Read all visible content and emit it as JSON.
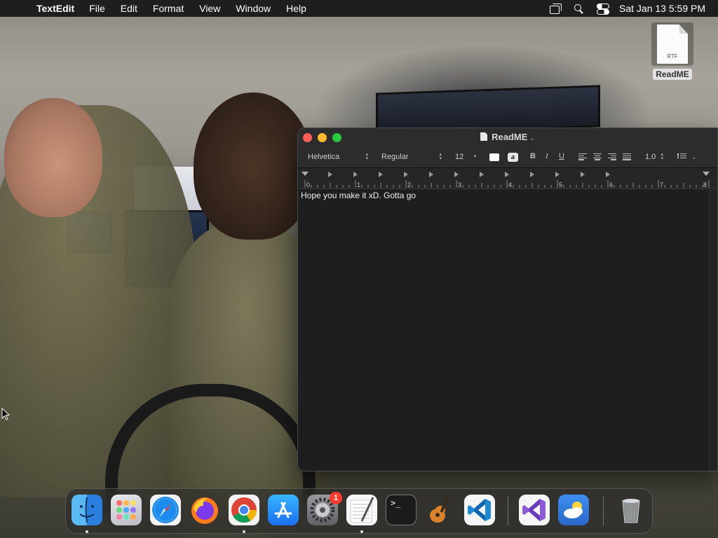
{
  "menubar": {
    "apple_glyph": "",
    "app_name": "TextEdit",
    "menus": [
      "File",
      "Edit",
      "Format",
      "View",
      "Window",
      "Help"
    ],
    "clock": "Sat Jan 13  5:59 PM",
    "status_icons": [
      "windows-icon",
      "search-icon",
      "control-center-icon"
    ]
  },
  "desktop": {
    "file": {
      "name": "ReadME",
      "type_label": "RTF"
    }
  },
  "window": {
    "title": "ReadME",
    "title_chevron": "⌄",
    "format_bar": {
      "font_family": "Helvetica",
      "font_style": "Regular",
      "font_size": "12",
      "highlight_glyph": "a",
      "bold": "B",
      "italic": "I",
      "underline": "U",
      "line_spacing": "1.0",
      "list_chevron": "⌄"
    },
    "ruler": {
      "labels": [
        "0",
        "1",
        "2",
        "3",
        "4",
        "5",
        "6",
        "7",
        "8"
      ]
    },
    "document_text": "Hope you make it xD. Gotta go"
  },
  "dock": {
    "apps": [
      {
        "name": "Finder",
        "icon": "finder-icon",
        "running": true
      },
      {
        "name": "Launchpad",
        "icon": "launchpad-icon",
        "running": false
      },
      {
        "name": "Safari",
        "icon": "safari-icon",
        "running": false
      },
      {
        "name": "Firefox",
        "icon": "firefox-icon",
        "running": false
      },
      {
        "name": "Chrome",
        "icon": "chrome-icon",
        "running": true
      },
      {
        "name": "App Store",
        "icon": "app-store-icon",
        "running": false
      },
      {
        "name": "System Settings",
        "icon": "settings-icon",
        "running": false,
        "badge": "1"
      },
      {
        "name": "TextEdit",
        "icon": "textedit-icon",
        "running": true
      },
      {
        "name": "Terminal",
        "icon": "terminal-icon",
        "running": false
      },
      {
        "name": "GarageBand",
        "icon": "garageband-icon",
        "running": false
      },
      {
        "name": "VS Code",
        "icon": "vscode-icon",
        "running": false
      },
      {
        "name": "Visual Studio",
        "icon": "visual-studio-icon",
        "running": false
      },
      {
        "name": "Weather",
        "icon": "weather-icon",
        "running": false
      },
      {
        "name": "Trash",
        "icon": "trash-icon",
        "running": false
      }
    ],
    "terminal_prompt": ">_"
  },
  "colors": {
    "close": "#ff5f57",
    "minimize": "#febc2e",
    "maximize": "#28c840",
    "badge": "#ff3b30",
    "menubar": "#1e1e1f",
    "window_bg": "#1e1e1e"
  }
}
